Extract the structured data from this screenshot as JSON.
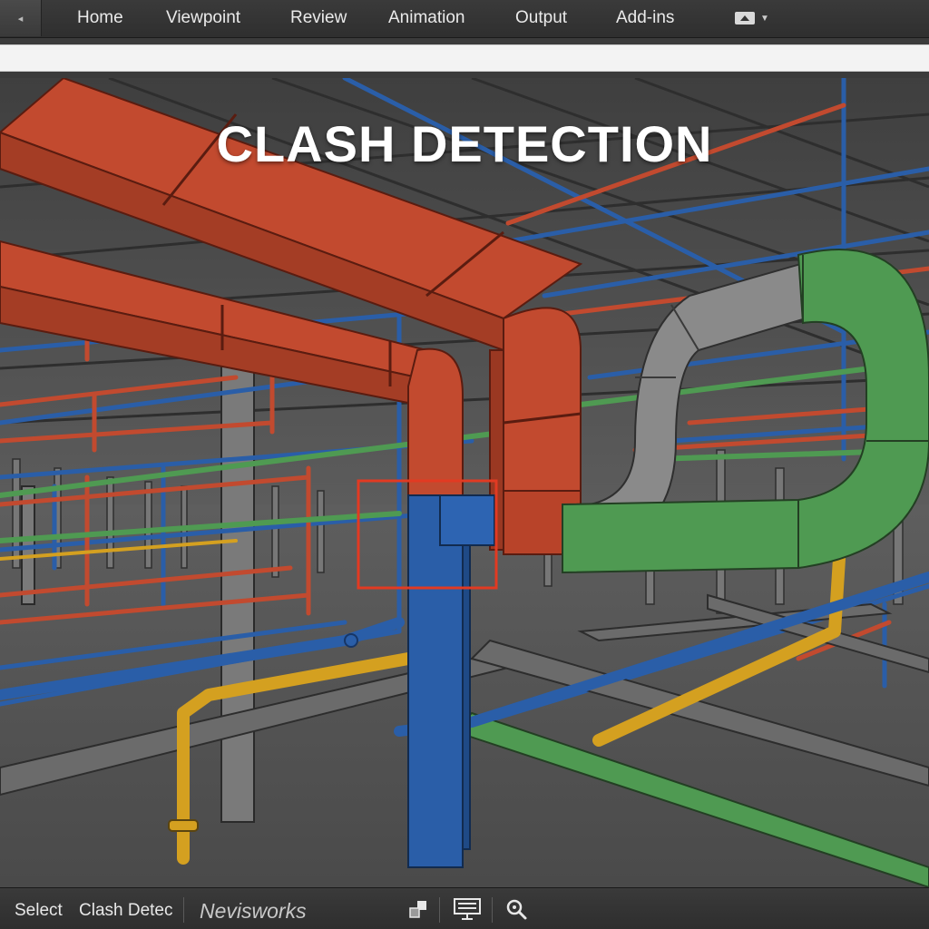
{
  "ribbon": {
    "collapse_glyph": "◂",
    "tabs": [
      {
        "label": "Home"
      },
      {
        "label": "Viewpoint"
      },
      {
        "label": "Review"
      },
      {
        "label": "Animation"
      },
      {
        "label": "Output"
      },
      {
        "label": "Add-ins"
      }
    ],
    "toggle_icon": "ribbon-minimize-icon"
  },
  "viewport": {
    "title": "CLASH DETECTION",
    "clash_marker_color": "#e23a22",
    "colors": {
      "duct": "#c24a2f",
      "pipe_blue": "#2a5ea8",
      "pipe_green": "#4f9a52",
      "pipe_gray": "#8a8a8a",
      "pipe_yellow": "#d4a020",
      "steel": "#6a6a6a"
    }
  },
  "statusbar": {
    "select_label": "Select",
    "clash_label": "Clash Detec",
    "brand": "Nevisworks",
    "icons": [
      "section-icon",
      "presentation-icon",
      "zoom-icon"
    ]
  }
}
